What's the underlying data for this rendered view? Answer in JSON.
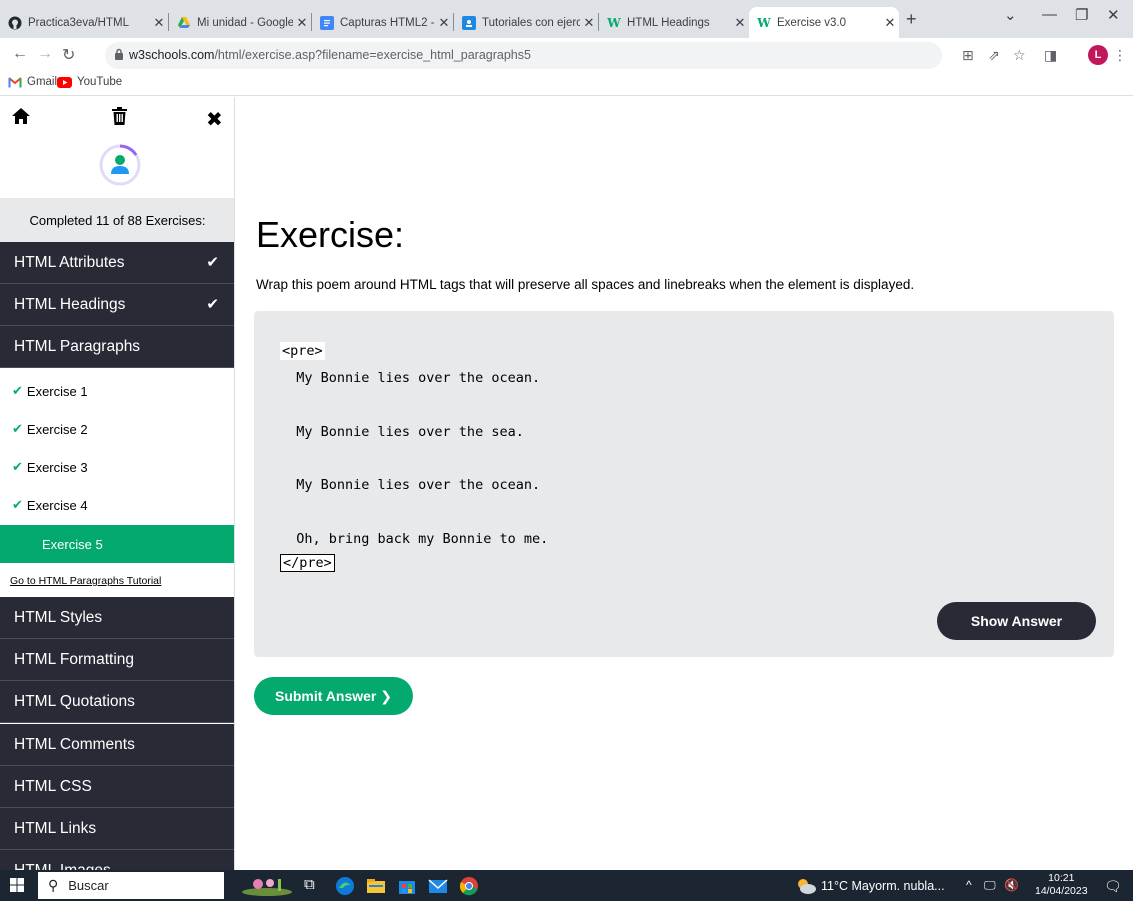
{
  "browser": {
    "tabs": [
      {
        "title": "Practica3eva/HTML",
        "icon": "github-icon"
      },
      {
        "title": "Mi unidad - Google",
        "icon": "google-drive-icon"
      },
      {
        "title": "Capturas HTML2 -",
        "icon": "google-docs-icon"
      },
      {
        "title": "Tutoriales con ejerc",
        "icon": "google-classroom-icon"
      },
      {
        "title": "HTML Headings",
        "icon": "w3schools-icon"
      },
      {
        "title": "Exercise v3.0",
        "icon": "w3schools-icon"
      }
    ],
    "url_host": "w3schools.com",
    "url_path": "/html/exercise.asp?filename=exercise_html_paragraphs5",
    "profile_initial": "L",
    "bookmarks": [
      {
        "label": "Gmail",
        "icon": "gmail-icon"
      },
      {
        "label": "YouTube",
        "icon": "youtube-icon"
      }
    ]
  },
  "sidebar": {
    "completed_text": "Completed 11 of 88 Exercises:",
    "sections_before": [
      {
        "label": "HTML Attributes",
        "done": true
      },
      {
        "label": "HTML Headings",
        "done": true
      }
    ],
    "current_section": "HTML Paragraphs",
    "exercises": [
      {
        "label": "Exercise 1",
        "done": true
      },
      {
        "label": "Exercise 2",
        "done": true
      },
      {
        "label": "Exercise 3",
        "done": true
      },
      {
        "label": "Exercise 4",
        "done": true
      },
      {
        "label": "Exercise 5",
        "done": false,
        "active": true
      }
    ],
    "tutorial_link": "Go to HTML Paragraphs Tutorial",
    "sections_after": [
      "HTML Styles",
      "HTML Formatting",
      "HTML Quotations",
      "HTML Comments",
      "HTML CSS",
      "HTML Links",
      "HTML Images"
    ]
  },
  "exercise": {
    "title": "Exercise:",
    "description": "Wrap this poem around HTML tags that will preserve all spaces and linebreaks when the element is displayed.",
    "open_tag_input": "<pre>",
    "lines": [
      "  My Bonnie lies over the ocean.",
      "  My Bonnie lies over the sea.",
      "  My Bonnie lies over the ocean.",
      "  Oh, bring back my Bonnie to me."
    ],
    "close_tag_input": "</pre>",
    "show_answer_label": "Show Answer",
    "submit_label": "Submit Answer ❯"
  },
  "taskbar": {
    "search_placeholder": "Buscar",
    "weather": "11°C  Mayorm. nubla...",
    "time": "10:21",
    "date": "14/04/2023"
  },
  "colors": {
    "w3_green": "#04aa6d",
    "sidebar_dark": "#282a35",
    "code_bg": "#e7e9eb"
  }
}
